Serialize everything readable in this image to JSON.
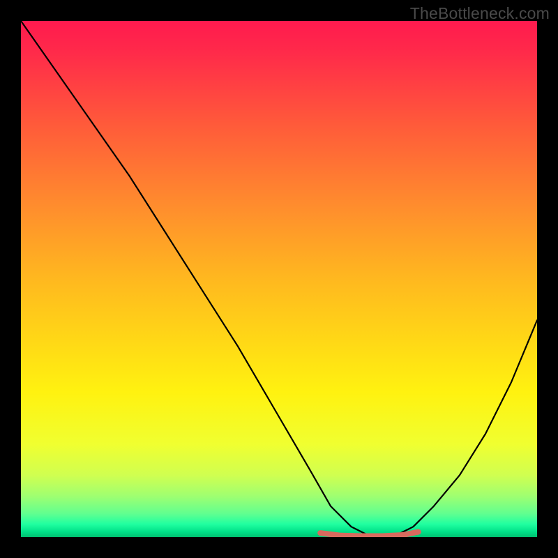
{
  "watermark": "TheBottleneck.com",
  "chart_data": {
    "type": "line",
    "title": "",
    "xlabel": "",
    "ylabel": "",
    "xlim": [
      0,
      100
    ],
    "ylim": [
      0,
      100
    ],
    "series": [
      {
        "name": "curve",
        "x": [
          0,
          7,
          14,
          21,
          28,
          35,
          42,
          49,
          56,
          60,
          64,
          68,
          72,
          76,
          80,
          85,
          90,
          95,
          100
        ],
        "values": [
          100,
          90,
          80,
          70,
          59,
          48,
          37,
          25,
          13,
          6,
          2,
          0,
          0,
          2,
          6,
          12,
          20,
          30,
          42
        ]
      },
      {
        "name": "flat-segment",
        "x": [
          58,
          62,
          66,
          70,
          74,
          77
        ],
        "values": [
          0.8,
          0.3,
          0.2,
          0.2,
          0.4,
          1.0
        ]
      }
    ],
    "gradient_stops": [
      {
        "offset": 0.0,
        "color": "#ff1a4e"
      },
      {
        "offset": 0.06,
        "color": "#ff2a4a"
      },
      {
        "offset": 0.2,
        "color": "#ff5a3a"
      },
      {
        "offset": 0.35,
        "color": "#ff8a2e"
      },
      {
        "offset": 0.5,
        "color": "#ffb81f"
      },
      {
        "offset": 0.62,
        "color": "#ffd816"
      },
      {
        "offset": 0.72,
        "color": "#fff210"
      },
      {
        "offset": 0.82,
        "color": "#f0ff30"
      },
      {
        "offset": 0.88,
        "color": "#d0ff50"
      },
      {
        "offset": 0.92,
        "color": "#a0ff70"
      },
      {
        "offset": 0.955,
        "color": "#60ff90"
      },
      {
        "offset": 0.975,
        "color": "#20ffa0"
      },
      {
        "offset": 0.99,
        "color": "#00e088"
      },
      {
        "offset": 1.0,
        "color": "#00c070"
      }
    ],
    "flat_segment_color": "#d86a5e"
  }
}
